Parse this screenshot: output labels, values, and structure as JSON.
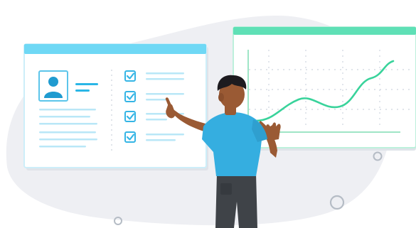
{
  "illustration": {
    "colors": {
      "background": "#ffffff",
      "blob": "#eeeff3",
      "panel_fill": "#ffffff",
      "panel_border": "#cdeef9",
      "left_panel_header": "#6fd8f5",
      "right_panel_header": "#5fe0b6",
      "accent_blue": "#2ab6e6",
      "line_light_blue": "#b9e7f7",
      "checkbox": "#35b5e5",
      "chart_line": "#39d39b",
      "chart_axis": "#9fe5c6",
      "grid_dot": "#d6dce3",
      "skin": "#9a5a34",
      "hair": "#1d1b1f",
      "shirt": "#35aee0",
      "pants": "#3f4348",
      "circle_outline": "#b5bcc5"
    },
    "left_panel": {
      "profile_card": "profile-card",
      "checklist_items_checked": [
        true,
        true,
        true,
        true
      ]
    },
    "right_panel": {
      "chart_shape": "rising-line"
    }
  }
}
